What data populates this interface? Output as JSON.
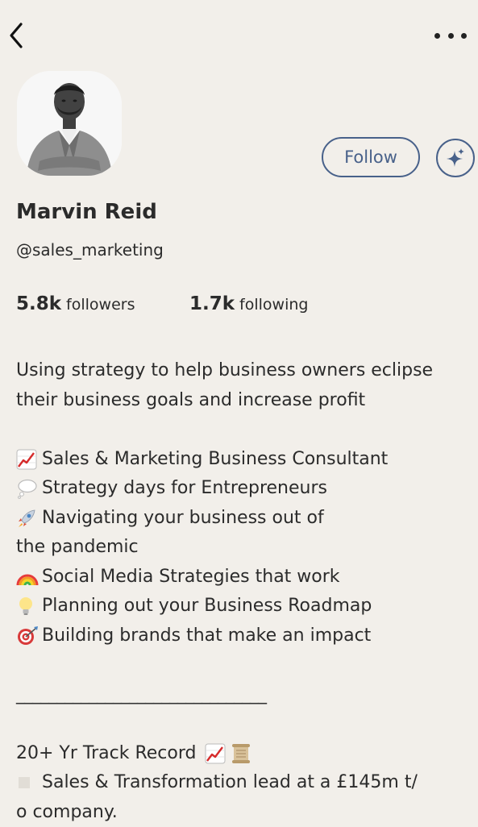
{
  "profile": {
    "name": "Marvin Reid",
    "handle": "@sales_marketing",
    "follow_label": "Follow",
    "followers_count": "5.8k",
    "followers_label": "followers",
    "following_count": "1.7k",
    "following_label": "following"
  },
  "bio": {
    "intro_line1": "Using strategy to help business owners eclipse",
    "intro_line2": "their business goals and increase profit",
    "bullets": [
      {
        "icon": "chart-increasing-icon",
        "text": "Sales & Marketing Business Consultant"
      },
      {
        "icon": "thought-bubble-icon",
        "text": "Strategy days for Entrepreneurs"
      },
      {
        "icon": "rocket-icon",
        "text": "Navigating your business out of"
      },
      {
        "icon": "",
        "text": "the pandemic"
      },
      {
        "icon": "rainbow-icon",
        "text": "Social Media Strategies that work"
      },
      {
        "icon": "light-bulb-icon",
        "text": "Planning out your Business Roadmap"
      },
      {
        "icon": "direct-hit-icon",
        "text": "Building brands that make an impact"
      }
    ],
    "divider": "_______________________________",
    "track_record": "20+ Yr Track Record",
    "bullet2_line1": "Sales & Transformation lead at a £145m t/",
    "bullet2_line2": "o company."
  },
  "colors": {
    "background": "#f2efea",
    "accent": "#48618a",
    "text": "#2b2b2b"
  },
  "icons": {
    "back": "chevron-left-icon",
    "more": "more-dots-icon",
    "spark": "sparkle-icon"
  }
}
